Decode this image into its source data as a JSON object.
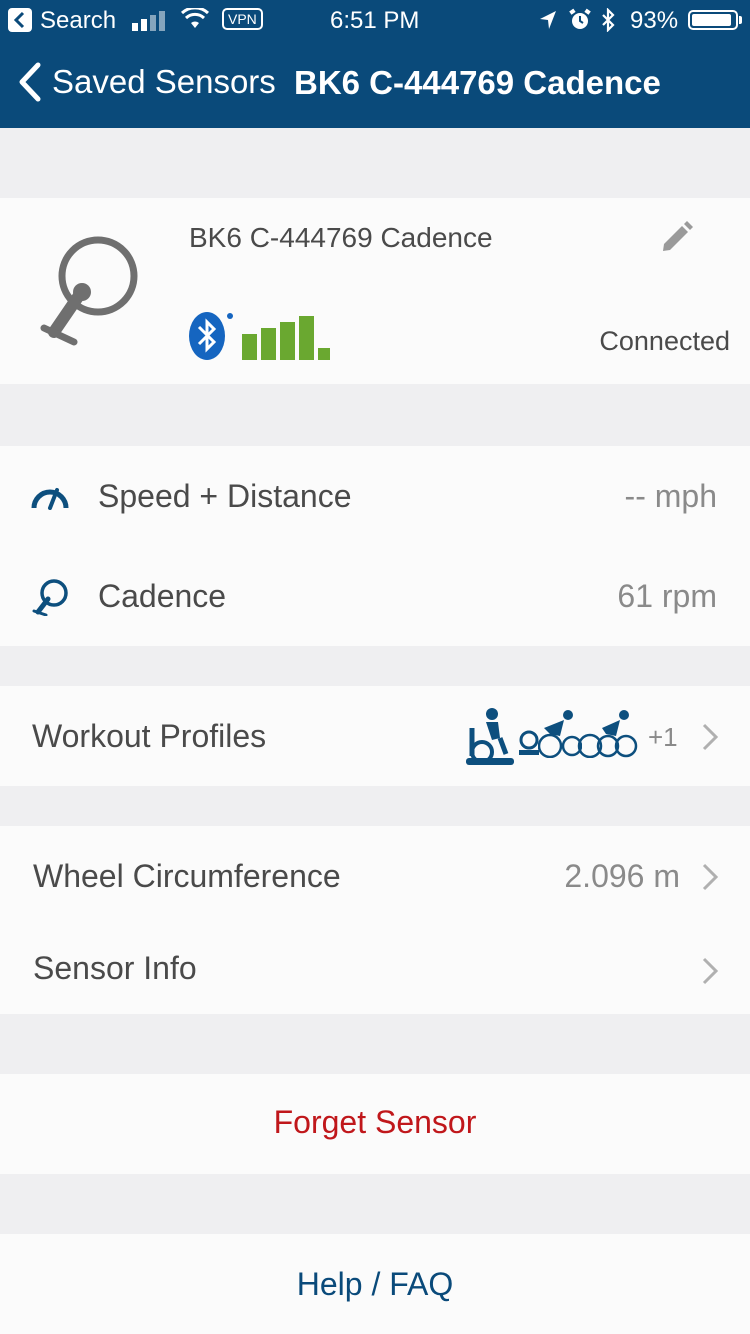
{
  "status_bar": {
    "back_app": "Search",
    "vpn": "VPN",
    "time": "6:51 PM",
    "battery": "93%",
    "battery_level": 0.93
  },
  "nav": {
    "back_label": "Saved Sensors",
    "title": "BK6 C-444769 Cadence"
  },
  "sensor": {
    "name": "BK6 C-444769 Cadence",
    "status": "Connected",
    "signal_bars": 4,
    "colors": {
      "bluetooth": "#1565c0",
      "signal": "#6aa830"
    }
  },
  "metrics": [
    {
      "label": "Speed + Distance",
      "value": "-- mph",
      "icon": "speedometer-icon"
    },
    {
      "label": "Cadence",
      "value": "61 rpm",
      "icon": "cadence-icon"
    }
  ],
  "workout_profiles": {
    "label": "Workout Profiles",
    "icons": [
      "stationary-bike-icon",
      "indoor-trainer-icon",
      "cycling-icon",
      "cycling-icon"
    ],
    "extra_count": "+1"
  },
  "settings": [
    {
      "label": "Wheel Circumference",
      "value": "2.096 m"
    },
    {
      "label": "Sensor Info",
      "value": ""
    }
  ],
  "actions": {
    "forget": "Forget Sensor",
    "help": "Help / FAQ"
  },
  "theme": {
    "nav_bg": "#0a4a7a",
    "destructive": "#c0171b",
    "link": "#0a4a7a",
    "icon_blue": "#0d4f7e"
  }
}
